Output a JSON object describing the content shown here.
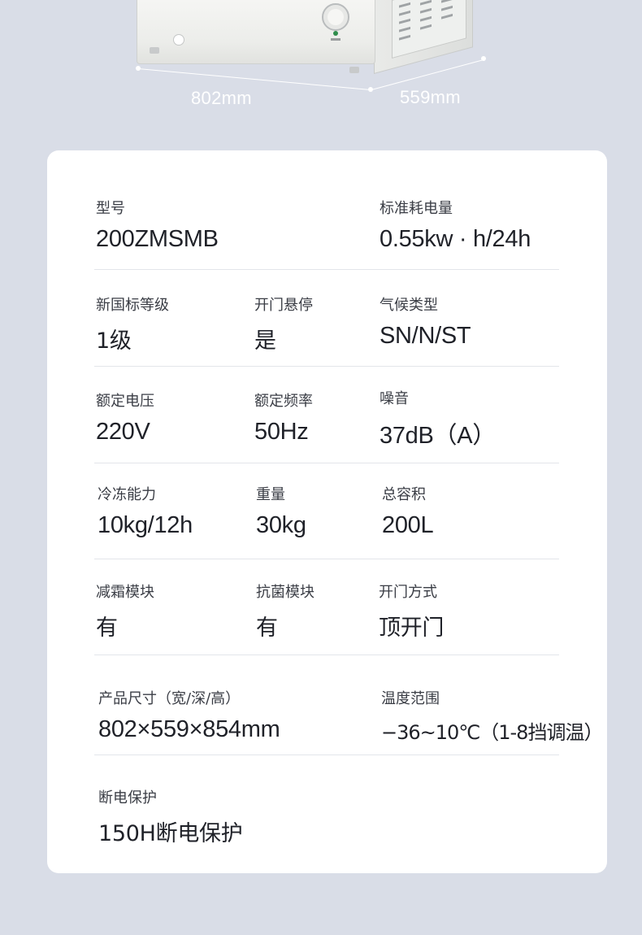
{
  "dimensions": {
    "width_label": "802mm",
    "depth_label": "559mm"
  },
  "specs": {
    "model": {
      "label": "型号",
      "value": "200ZMSMB"
    },
    "energy": {
      "label": "标准耗电量",
      "value": "0.55kw · h/24h"
    },
    "grade": {
      "label": "新国标等级",
      "value": "1级"
    },
    "door_hover": {
      "label": "开门悬停",
      "value": "是"
    },
    "climate": {
      "label": "气候类型",
      "value": "SN/N/ST"
    },
    "voltage": {
      "label": "额定电压",
      "value": "220V"
    },
    "frequency": {
      "label": "额定频率",
      "value": "50Hz"
    },
    "noise": {
      "label": "噪音",
      "value": "37dB（A）"
    },
    "freezing": {
      "label": "冷冻能力",
      "value": "10kg/12h"
    },
    "weight": {
      "label": "重量",
      "value": "30kg"
    },
    "capacity": {
      "label": "总容积",
      "value": "200L"
    },
    "defrost": {
      "label": "减霜模块",
      "value": "有"
    },
    "antibacterial": {
      "label": "抗菌模块",
      "value": "有"
    },
    "door_type": {
      "label": "开门方式",
      "value": "顶开门"
    },
    "size": {
      "label": "产品尺寸（宽/深/高）",
      "value": "802×559×854mm"
    },
    "temperature": {
      "label": "温度范围",
      "value": "−36~10℃（1-8挡调温）"
    },
    "power_off": {
      "label": "断电保护",
      "value": "150H断电保护"
    }
  }
}
